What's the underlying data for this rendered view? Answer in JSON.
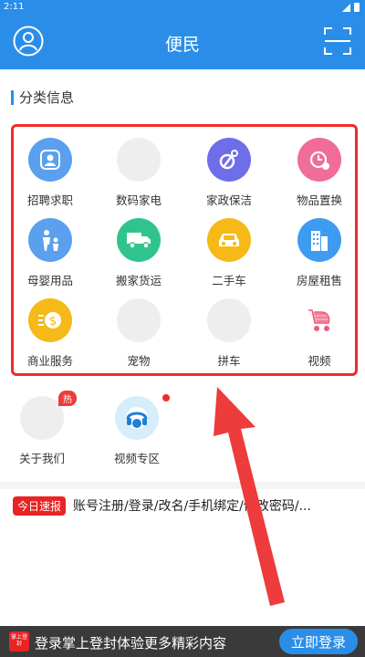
{
  "status": {
    "time": "2:11"
  },
  "header": {
    "title": "便民"
  },
  "section": {
    "title": "分类信息"
  },
  "grid": [
    {
      "label": "招聘求职",
      "icon": "job-icon",
      "color": "#5aa0ee"
    },
    {
      "label": "数码家电",
      "icon": "placeholder-icon",
      "color": "#eeeeee"
    },
    {
      "label": "家政保洁",
      "icon": "cleaning-icon",
      "color": "#6f6de8"
    },
    {
      "label": "物品置换",
      "icon": "exchange-icon",
      "color": "#ef6d98"
    },
    {
      "label": "母婴用品",
      "icon": "mother-baby-icon",
      "color": "#5aa0ee"
    },
    {
      "label": "搬家货运",
      "icon": "moving-truck-icon",
      "color": "#2fc48e"
    },
    {
      "label": "二手车",
      "icon": "used-car-icon",
      "color": "#f5b918"
    },
    {
      "label": "房屋租售",
      "icon": "building-icon",
      "color": "#3e9cf0"
    },
    {
      "label": "商业服务",
      "icon": "coin-icon",
      "color": "#f5b918"
    },
    {
      "label": "宠物",
      "icon": "placeholder-icon",
      "color": "#eeeeee"
    },
    {
      "label": "拼车",
      "icon": "placeholder-icon",
      "color": "#eeeeee"
    },
    {
      "label": "视频",
      "icon": "stroller-icon",
      "color": "#ffffff"
    }
  ],
  "extra": [
    {
      "label": "关于我们",
      "badge": "热"
    },
    {
      "label": "视频专区"
    }
  ],
  "news": {
    "tag": "今日速报",
    "text": "账号注册/登录/改名/手机绑定/修改密码/..."
  },
  "bottom": {
    "logo_text": "掌上登封",
    "message": "登录掌上登封体验更多精彩内容",
    "login_label": "立即登录"
  }
}
